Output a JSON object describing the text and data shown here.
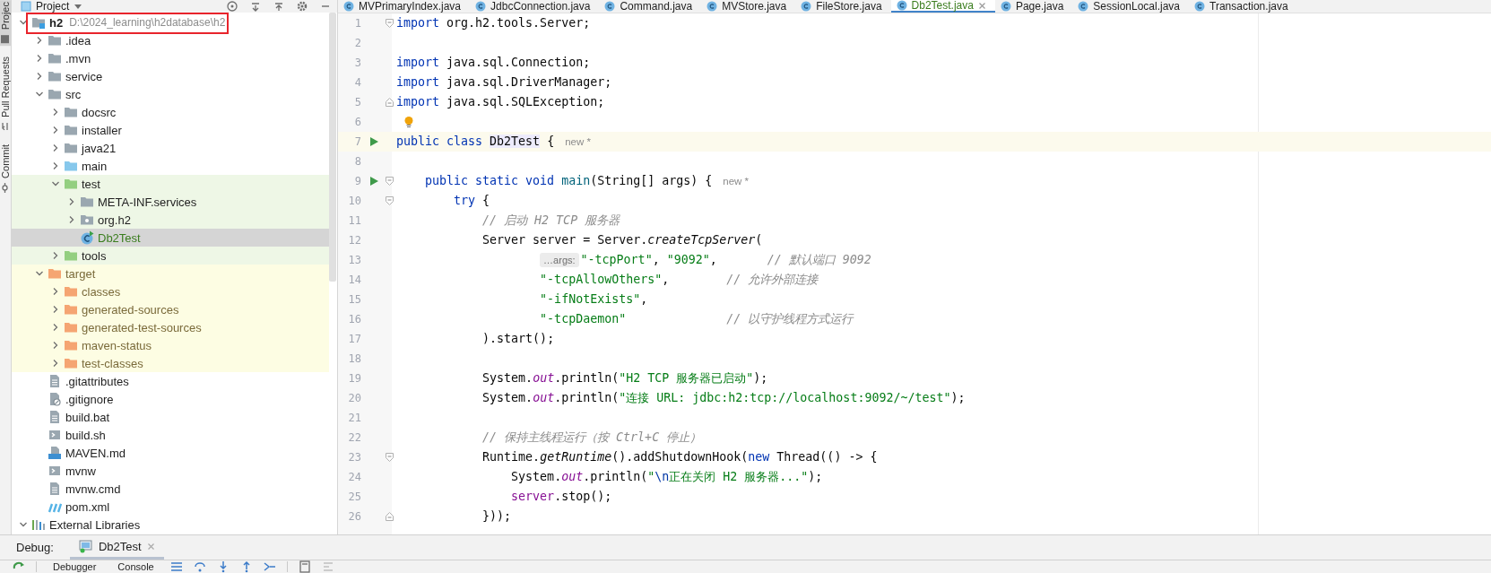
{
  "tool_strip": [
    {
      "label": "Projec",
      "kind": "project",
      "selected": true
    },
    {
      "label": "Pull Requests",
      "kind": "pull-requests",
      "selected": false
    },
    {
      "label": "Commit",
      "kind": "commit",
      "selected": false
    }
  ],
  "project_panel": {
    "title": "Project",
    "tree": [
      {
        "label": "h2",
        "kind": "module",
        "path": "D:\\2024_learning\\h2database\\h2",
        "expanded": true,
        "selected": false,
        "children": [
          {
            "label": ".idea",
            "kind": "folder",
            "expanded": false,
            "selected": false
          },
          {
            "label": ".mvn",
            "kind": "folder",
            "expanded": false,
            "selected": false
          },
          {
            "label": "service",
            "kind": "folder",
            "expanded": false,
            "selected": false
          },
          {
            "label": "src",
            "kind": "folder",
            "expanded": true,
            "selected": false,
            "children": [
              {
                "label": "docsrc",
                "kind": "folder",
                "expanded": false,
                "selected": false
              },
              {
                "label": "installer",
                "kind": "folder",
                "expanded": false,
                "selected": false
              },
              {
                "label": "java21",
                "kind": "folder",
                "expanded": false,
                "selected": false
              },
              {
                "label": "main",
                "kind": "source-folder",
                "expanded": false,
                "selected": false
              },
              {
                "label": "test",
                "kind": "test-folder",
                "test_scope": true,
                "expanded": true,
                "selected": false,
                "children": [
                  {
                    "label": "META-INF.services",
                    "kind": "folder",
                    "test_scope": true,
                    "expanded": false,
                    "selected": false
                  },
                  {
                    "label": "org.h2",
                    "kind": "package",
                    "test_scope": true,
                    "expanded": false,
                    "selected": false
                  },
                  {
                    "label": "Db2Test",
                    "kind": "class",
                    "test_scope": true,
                    "added": true,
                    "selected": true
                  }
                ]
              },
              {
                "label": "tools",
                "kind": "test-folder",
                "test_scope": true,
                "expanded": false,
                "selected": false
              }
            ]
          },
          {
            "label": "target",
            "kind": "excluded-folder",
            "excluded": true,
            "expanded": true,
            "selected": false,
            "children": [
              {
                "label": "classes",
                "kind": "excluded-folder",
                "excluded": true,
                "expanded": false,
                "selected": false
              },
              {
                "label": "generated-sources",
                "kind": "excluded-folder",
                "excluded": true,
                "expanded": false,
                "selected": false
              },
              {
                "label": "generated-test-sources",
                "kind": "excluded-folder",
                "excluded": true,
                "expanded": false,
                "selected": false
              },
              {
                "label": "maven-status",
                "kind": "excluded-folder",
                "excluded": true,
                "expanded": false,
                "selected": false
              },
              {
                "label": "test-classes",
                "kind": "excluded-folder",
                "excluded": true,
                "expanded": false,
                "selected": false
              }
            ]
          },
          {
            "label": ".gitattributes",
            "kind": "text-file",
            "selected": false
          },
          {
            "label": ".gitignore",
            "kind": "ignore-file",
            "selected": false
          },
          {
            "label": "build.bat",
            "kind": "text-file",
            "selected": false
          },
          {
            "label": "build.sh",
            "kind": "script-file",
            "selected": false
          },
          {
            "label": "MAVEN.md",
            "kind": "markdown-file",
            "selected": false
          },
          {
            "label": "mvnw",
            "kind": "script-file",
            "selected": false
          },
          {
            "label": "mvnw.cmd",
            "kind": "text-file",
            "selected": false
          },
          {
            "label": "pom.xml",
            "kind": "maven-file",
            "selected": false
          }
        ]
      },
      {
        "label": "External Libraries",
        "kind": "libraries",
        "expanded": true,
        "selected": false
      }
    ]
  },
  "editor": {
    "tabs": [
      {
        "label": "MVPrimaryIndex.java",
        "selected": false
      },
      {
        "label": "JdbcConnection.java",
        "selected": false
      },
      {
        "label": "Command.java",
        "selected": false
      },
      {
        "label": "MVStore.java",
        "selected": false
      },
      {
        "label": "FileStore.java",
        "selected": false
      },
      {
        "label": "Db2Test.java",
        "selected": true,
        "added": true
      },
      {
        "label": "Page.java",
        "selected": false
      },
      {
        "label": "SessionLocal.java",
        "selected": false
      },
      {
        "label": "Transaction.java",
        "selected": false
      }
    ],
    "lines": [
      {
        "number": "1",
        "current": false,
        "fold_start": true,
        "tokens": [
          {
            "kind": "keyword",
            "text": "import"
          },
          {
            "kind": "plain",
            "text": " org.h2.tools.Server;"
          }
        ]
      },
      {
        "number": "2",
        "current": false
      },
      {
        "number": "3",
        "current": false,
        "tokens": [
          {
            "kind": "keyword",
            "text": "import"
          },
          {
            "kind": "plain",
            "text": " java.sql.Connection;"
          }
        ]
      },
      {
        "number": "4",
        "current": false,
        "tokens": [
          {
            "kind": "keyword",
            "text": "import"
          },
          {
            "kind": "plain",
            "text": " java.sql.DriverManager;"
          }
        ]
      },
      {
        "number": "5",
        "current": false,
        "fold_end": true,
        "tokens": [
          {
            "kind": "keyword",
            "text": "import"
          },
          {
            "kind": "plain",
            "text": " java.sql.SQLException;"
          }
        ]
      },
      {
        "number": "6",
        "current": false,
        "bulb": true
      },
      {
        "number": "7",
        "current": true,
        "run": true,
        "tokens": [
          {
            "kind": "keyword",
            "text": "public class "
          },
          {
            "kind": "symbol-highlight",
            "text": "Db2Test"
          },
          {
            "kind": "plain",
            "text": " {"
          },
          {
            "kind": "author-hint",
            "text": "new *"
          }
        ]
      },
      {
        "number": "8",
        "current": false
      },
      {
        "number": "9",
        "current": false,
        "run": true,
        "fold_start": true,
        "tokens": [
          {
            "kind": "keyword",
            "text": "    public static void "
          },
          {
            "kind": "method-decl",
            "text": "main"
          },
          {
            "kind": "plain",
            "text": "(String[] args) {"
          },
          {
            "kind": "author-hint",
            "text": "new *"
          }
        ]
      },
      {
        "number": "10",
        "current": false,
        "fold_start": true,
        "tokens": [
          {
            "kind": "keyword",
            "text": "        try"
          },
          {
            "kind": "plain",
            "text": " {"
          }
        ]
      },
      {
        "number": "11",
        "current": false,
        "tokens": [
          {
            "kind": "comment",
            "text": "            // 启动 H2 TCP 服务器"
          }
        ]
      },
      {
        "number": "12",
        "current": false,
        "tokens": [
          {
            "kind": "plain",
            "text": "            Server server = Server."
          },
          {
            "kind": "static-call",
            "text": "createTcpServer"
          },
          {
            "kind": "plain",
            "text": "("
          }
        ]
      },
      {
        "number": "13",
        "current": false,
        "tokens": [
          {
            "kind": "param-hint",
            "text": "                    …args:"
          },
          {
            "kind": "string",
            "text": "\"-tcpPort\""
          },
          {
            "kind": "plain",
            "text": ", "
          },
          {
            "kind": "string",
            "text": "\"9092\""
          },
          {
            "kind": "plain",
            "text": ",       "
          },
          {
            "kind": "comment",
            "text": "// 默认端口 9092"
          }
        ]
      },
      {
        "number": "14",
        "current": false,
        "tokens": [
          {
            "kind": "string",
            "text": "                    \"-tcpAllowOthers\""
          },
          {
            "kind": "plain",
            "text": ",        "
          },
          {
            "kind": "comment",
            "text": "// 允许外部连接"
          }
        ]
      },
      {
        "number": "15",
        "current": false,
        "tokens": [
          {
            "kind": "string",
            "text": "                    \"-ifNotExists\""
          },
          {
            "kind": "plain",
            "text": ","
          }
        ]
      },
      {
        "number": "16",
        "current": false,
        "tokens": [
          {
            "kind": "string",
            "text": "                    \"-tcpDaemon\""
          },
          {
            "kind": "comment",
            "text": "              // 以守护线程方式运行"
          }
        ]
      },
      {
        "number": "17",
        "current": false,
        "tokens": [
          {
            "kind": "plain",
            "text": "            ).start();"
          }
        ]
      },
      {
        "number": "18",
        "current": false
      },
      {
        "number": "19",
        "current": false,
        "tokens": [
          {
            "kind": "plain",
            "text": "            System."
          },
          {
            "kind": "field",
            "text": "out"
          },
          {
            "kind": "plain",
            "text": ".println("
          },
          {
            "kind": "string",
            "text": "\"H2 TCP 服务器已启动\""
          },
          {
            "kind": "plain",
            "text": ");"
          }
        ]
      },
      {
        "number": "20",
        "current": false,
        "tokens": [
          {
            "kind": "plain",
            "text": "            System."
          },
          {
            "kind": "field",
            "text": "out"
          },
          {
            "kind": "plain",
            "text": ".println("
          },
          {
            "kind": "string",
            "text": "\"连接 URL: jdbc:h2:tcp://localhost:9092/~/test\""
          },
          {
            "kind": "plain",
            "text": ");"
          }
        ]
      },
      {
        "number": "21",
        "current": false
      },
      {
        "number": "22",
        "current": false,
        "tokens": [
          {
            "kind": "comment",
            "text": "            // 保持主线程运行（按 Ctrl+C 停止）"
          }
        ]
      },
      {
        "number": "23",
        "current": false,
        "fold_start": true,
        "tokens": [
          {
            "kind": "plain",
            "text": "            Runtime."
          },
          {
            "kind": "static-call",
            "text": "getRuntime"
          },
          {
            "kind": "plain",
            "text": "().addShutdownHook("
          },
          {
            "kind": "keyword",
            "text": "new"
          },
          {
            "kind": "plain",
            "text": " Thread(() -> {"
          }
        ]
      },
      {
        "number": "24",
        "current": false,
        "tokens": [
          {
            "kind": "plain",
            "text": "                System."
          },
          {
            "kind": "field",
            "text": "out"
          },
          {
            "kind": "plain",
            "text": ".println("
          },
          {
            "kind": "string",
            "text": "\""
          },
          {
            "kind": "escape",
            "text": "\\n"
          },
          {
            "kind": "string",
            "text": "正在关闭 H2 服务器...\""
          },
          {
            "kind": "plain",
            "text": ");"
          }
        ]
      },
      {
        "number": "25",
        "current": false,
        "tokens": [
          {
            "kind": "local",
            "text": "                server"
          },
          {
            "kind": "plain",
            "text": ".stop();"
          }
        ]
      },
      {
        "number": "26",
        "current": false,
        "fold_end": true,
        "tokens": [
          {
            "kind": "plain",
            "text": "            }));"
          }
        ]
      }
    ]
  },
  "debug_panel": {
    "label": "Debug:",
    "tabs": [
      {
        "label": "Db2Test",
        "selected": true
      }
    ],
    "toolbar_tabs": [
      {
        "label": "Debugger",
        "selected": false
      },
      {
        "label": "Console",
        "selected": false
      }
    ]
  }
}
